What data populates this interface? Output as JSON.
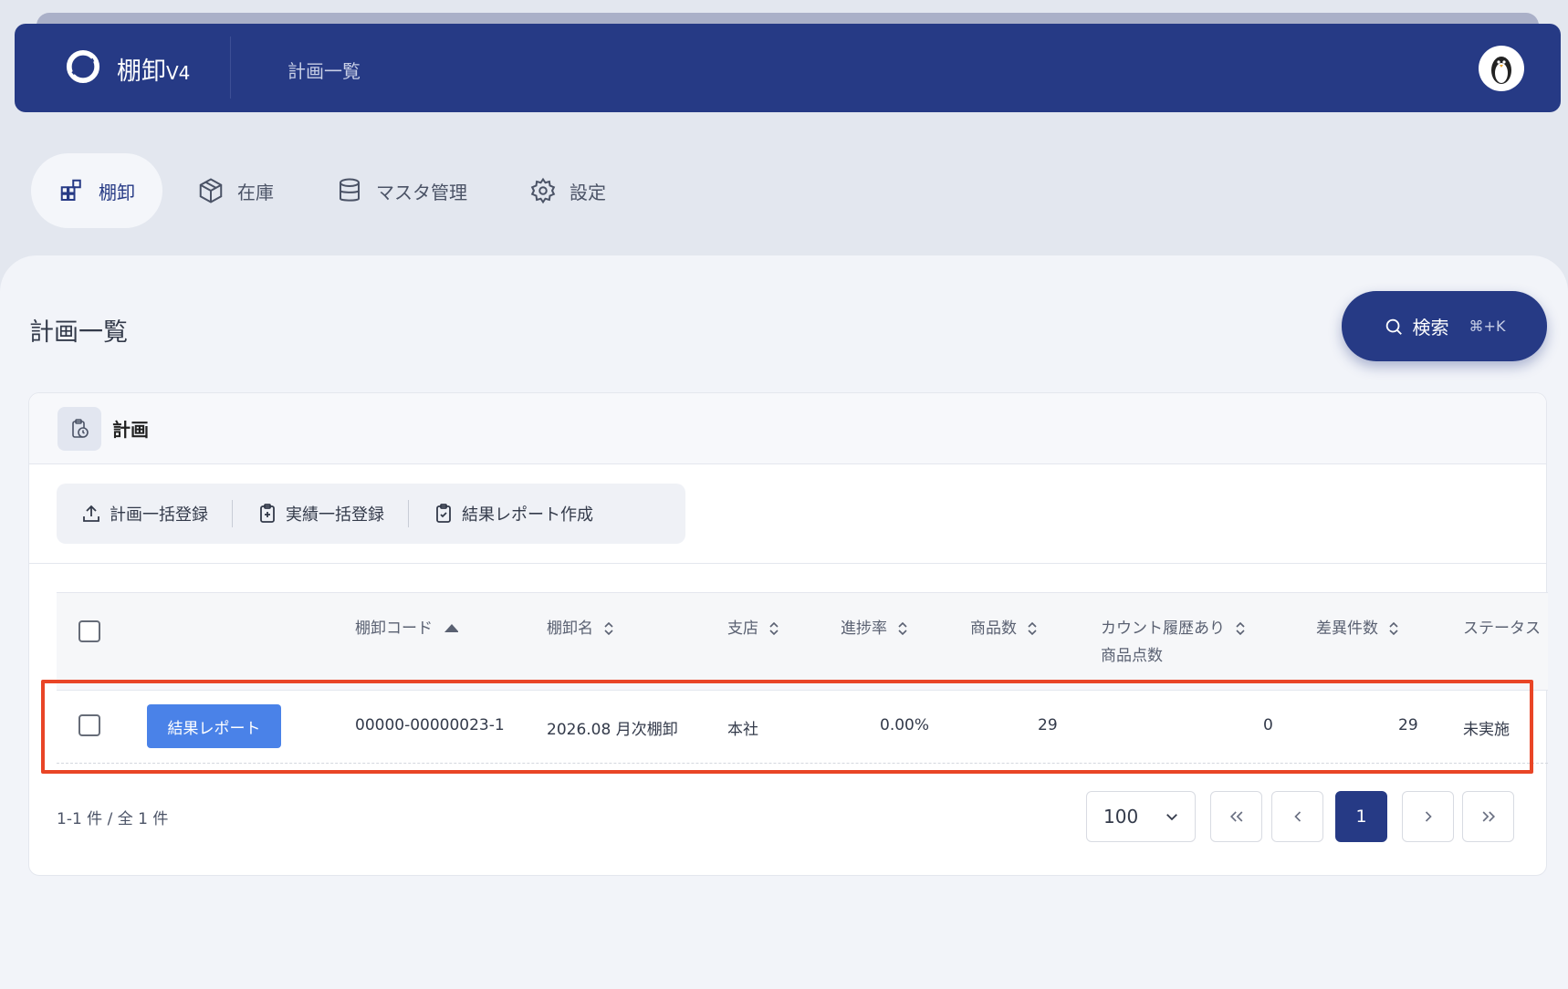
{
  "header": {
    "app_name": "棚卸",
    "app_version": "V4",
    "breadcrumb": "計画一覧"
  },
  "nav": {
    "items": [
      {
        "label": "棚卸",
        "icon": "grid-icon",
        "active": true
      },
      {
        "label": "在庫",
        "icon": "box-icon",
        "active": false
      },
      {
        "label": "マスタ管理",
        "icon": "database-icon",
        "active": false
      },
      {
        "label": "設定",
        "icon": "gear-icon",
        "active": false
      }
    ]
  },
  "page": {
    "title": "計画一覧",
    "search_label": "検索",
    "search_shortcut": "⌘+K"
  },
  "card": {
    "title": "計画",
    "toolbar": {
      "bulk_plan": "計画一括登録",
      "bulk_actual": "実績一括登録",
      "create_report": "結果レポート作成"
    }
  },
  "table": {
    "columns": [
      "棚卸コード",
      "棚卸名",
      "支店",
      "進捗率",
      "商品数",
      "カウント履歴あり",
      "商品点数",
      "差異件数",
      "ステータス"
    ],
    "rows": [
      {
        "action": "結果レポート",
        "code": "00000-00000023-1",
        "name": "2026.08 月次棚卸",
        "branch": "本社",
        "progress": "0.00%",
        "items": "29",
        "counted": "0",
        "diff": "29",
        "status": "未実施"
      }
    ]
  },
  "pagination": {
    "summary": "1-1 件 / 全 1 件",
    "per_page": "100",
    "current_page": "1"
  },
  "colors": {
    "primary": "#263a85",
    "accent_button": "#4a82e8",
    "highlight": "#e94526"
  }
}
